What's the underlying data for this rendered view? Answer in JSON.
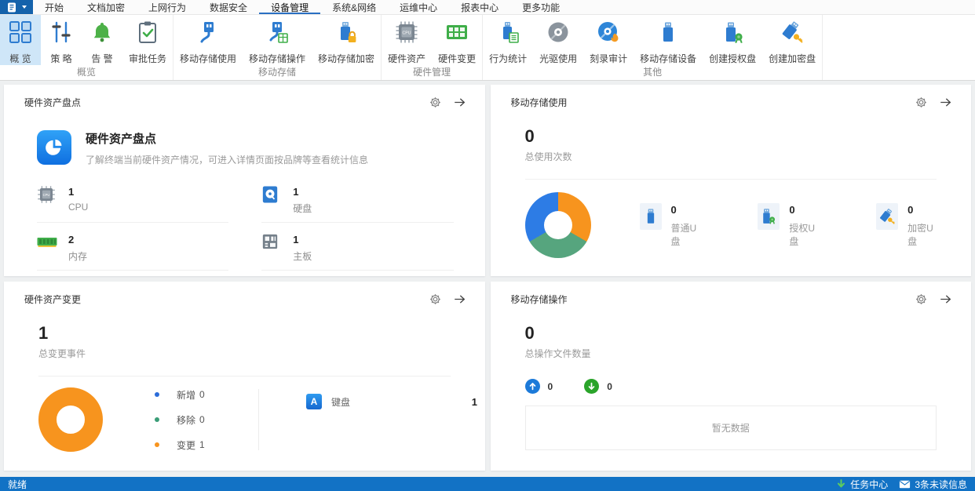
{
  "menu_bar": {
    "items": [
      "开始",
      "文档加密",
      "上网行为",
      "数据安全",
      "设备管理",
      "系统&网络",
      "运维中心",
      "报表中心",
      "更多功能"
    ],
    "selected": "设备管理"
  },
  "ribbon": {
    "groups": [
      {
        "label": "概览",
        "buttons": [
          {
            "label": "概 览",
            "icon": "grid-icon",
            "selected": true
          },
          {
            "label": "策 略",
            "icon": "sliders-icon"
          },
          {
            "label": "告 警",
            "icon": "bell-icon"
          },
          {
            "label": "审批任务",
            "icon": "clipboard-check-icon"
          }
        ]
      },
      {
        "label": "移动存储",
        "buttons": [
          {
            "label": "移动存储使用",
            "icon": "usb-plug-icon"
          },
          {
            "label": "移动存储操作",
            "icon": "usb-plug-table-icon"
          },
          {
            "label": "移动存储加密",
            "icon": "usb-lock-icon"
          }
        ]
      },
      {
        "label": "硬件管理",
        "buttons": [
          {
            "label": "硬件资产",
            "icon": "cpu-icon"
          },
          {
            "label": "硬件变更",
            "icon": "circuit-board-icon"
          }
        ]
      },
      {
        "label": "其他",
        "buttons": [
          {
            "label": "行为统计",
            "icon": "usb-list-icon"
          },
          {
            "label": "光驱使用",
            "icon": "disc-icon"
          },
          {
            "label": "刻录审计",
            "icon": "disc-burn-icon"
          },
          {
            "label": "移动存储设备",
            "icon": "usb-stick-icon"
          },
          {
            "label": "创建授权盘",
            "icon": "usb-badge-icon"
          },
          {
            "label": "创建加密盘",
            "icon": "usb-key-icon"
          }
        ]
      }
    ]
  },
  "cards": {
    "hardware_inventory": {
      "title": "硬件资产盘点",
      "feature_title": "硬件资产盘点",
      "feature_desc": "了解终端当前硬件资产情况，可进入详情页面按品牌等查看统计信息",
      "stats": [
        {
          "value": "1",
          "label": "CPU",
          "icon": "cpu-chip-icon"
        },
        {
          "value": "1",
          "label": "硬盘",
          "icon": "hard-disk-icon"
        },
        {
          "value": "2",
          "label": "内存",
          "icon": "ram-icon"
        },
        {
          "value": "1",
          "label": "主板",
          "icon": "motherboard-icon"
        }
      ]
    },
    "storage_usage": {
      "title": "移动存储使用",
      "total_value": "0",
      "total_label": "总使用次数",
      "legend": [
        {
          "value": "0",
          "label": "普通U盘",
          "icon": "usb-plain-icon"
        },
        {
          "value": "0",
          "label": "授权U盘",
          "icon": "usb-authorized-icon"
        },
        {
          "value": "0",
          "label": "加密U盘",
          "icon": "usb-encrypted-icon"
        }
      ]
    },
    "hardware_change": {
      "title": "硬件资产变更",
      "total_value": "1",
      "total_label": "总变更事件",
      "legend": [
        {
          "label": "新增",
          "value": "0",
          "color": "#2b6cd9"
        },
        {
          "label": "移除",
          "value": "0",
          "color": "#3a9d77"
        },
        {
          "label": "变更",
          "value": "1",
          "color": "#f7941e"
        }
      ],
      "devices": [
        {
          "label": "键盘",
          "value": "1",
          "icon": "keyboard-a-icon"
        }
      ]
    },
    "storage_operation": {
      "title": "移动存储操作",
      "total_value": "0",
      "total_label": "总操作文件数量",
      "upload_value": "0",
      "download_value": "0",
      "empty_text": "暂无数据"
    }
  },
  "status_bar": {
    "ready": "就绪",
    "task_center": "任务中心",
    "unread": "3条未读信息"
  },
  "colors": {
    "accent_blue": "#2a6fc2",
    "app_button_bg": "#1462ab",
    "status_bar_bg": "#1272c5",
    "selected_ribbon_bg": "#cfe6f8",
    "donut_blue": "#2d7ce5",
    "donut_orange": "#f7941e",
    "donut_green": "#56a57e",
    "upload_circle": "#1c7ad9",
    "download_circle": "#2aa42a"
  },
  "chart_data": [
    {
      "type": "pie",
      "title": "移动存储使用",
      "categories": [
        "普通U盘",
        "授权U盘",
        "加密U盘"
      ],
      "values": [
        0,
        0,
        0
      ],
      "colors": [
        "#2d7ce5",
        "#56a57e",
        "#f7941e"
      ],
      "note": "equal-thirds placeholder donut, all values 0"
    },
    {
      "type": "pie",
      "title": "硬件资产变更",
      "categories": [
        "新增",
        "移除",
        "变更"
      ],
      "values": [
        0,
        0,
        1
      ],
      "colors": [
        "#2b6cd9",
        "#3a9d77",
        "#f7941e"
      ]
    }
  ]
}
